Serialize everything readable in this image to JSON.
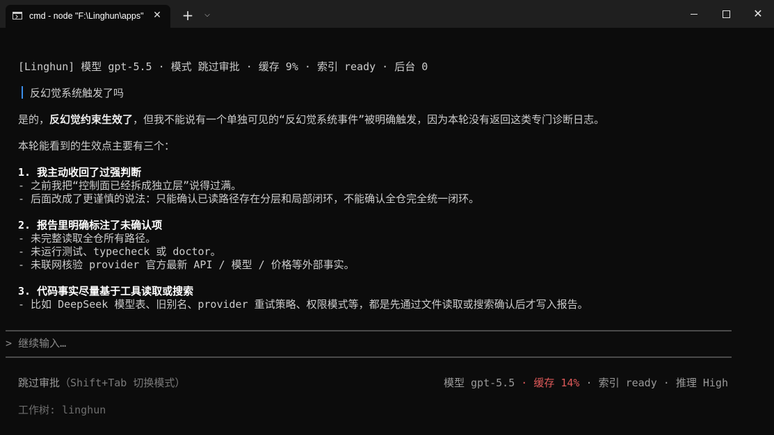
{
  "window": {
    "tab_title": "cmd - node  \"F:\\Linghun\\apps\"",
    "close_glyph": "✕",
    "newtab_glyph": "+",
    "menu_glyph": "⌵"
  },
  "header": {
    "line": "[Linghun] 模型 gpt-5.5 · 模式 跳过审批 · 缓存 9% · 索引 ready · 后台 0"
  },
  "user_message": "反幻觉系统触发了吗",
  "response": {
    "intro_prefix": "是的，",
    "intro_bold": "反幻觉约束生效了",
    "intro_suffix": "，但我不能说有一个单独可见的“反幻觉系统事件”被明确触发，因为本轮没有返回这类专门诊断日志。",
    "summary": "本轮能看到的生效点主要有三个：",
    "sections": [
      {
        "heading": "1. 我主动收回了过强判断",
        "items": [
          "- 之前我把“控制面已经拆成独立层”说得过满。",
          "- 后面改成了更谨慎的说法：只能确认已读路径存在分层和局部闭环，不能确认全仓完全统一闭环。"
        ]
      },
      {
        "heading": "2. 报告里明确标注了未确认项",
        "items": [
          "- 未完整读取全仓所有路径。",
          "- 未运行测试、typecheck 或 doctor。",
          "- 未联网核验 provider 官方最新 API / 模型 / 价格等外部事实。"
        ]
      },
      {
        "heading": "3. 代码事实尽量基于工具读取或搜索",
        "items": [
          "- 比如 DeepSeek 模型表、旧别名、provider 重试策略、权限模式等，都是先通过文件读取或搜索确认后才写入报告。"
        ]
      }
    ]
  },
  "input": {
    "prompt_symbol": ">",
    "placeholder": "继续输入…"
  },
  "status": {
    "mode": "跳过审批",
    "mode_hint": "（Shift+Tab 切换模式）",
    "model": "模型 gpt-5.5",
    "cache": "缓存 14%",
    "index": "索引 ready",
    "reasoning": "推理 High",
    "separator": " · ",
    "worktree": "工作树: linghun"
  },
  "colors": {
    "background": "#0c0c0c",
    "accent_quote": "#3b8eea",
    "cache_warning": "#e05a5a"
  }
}
